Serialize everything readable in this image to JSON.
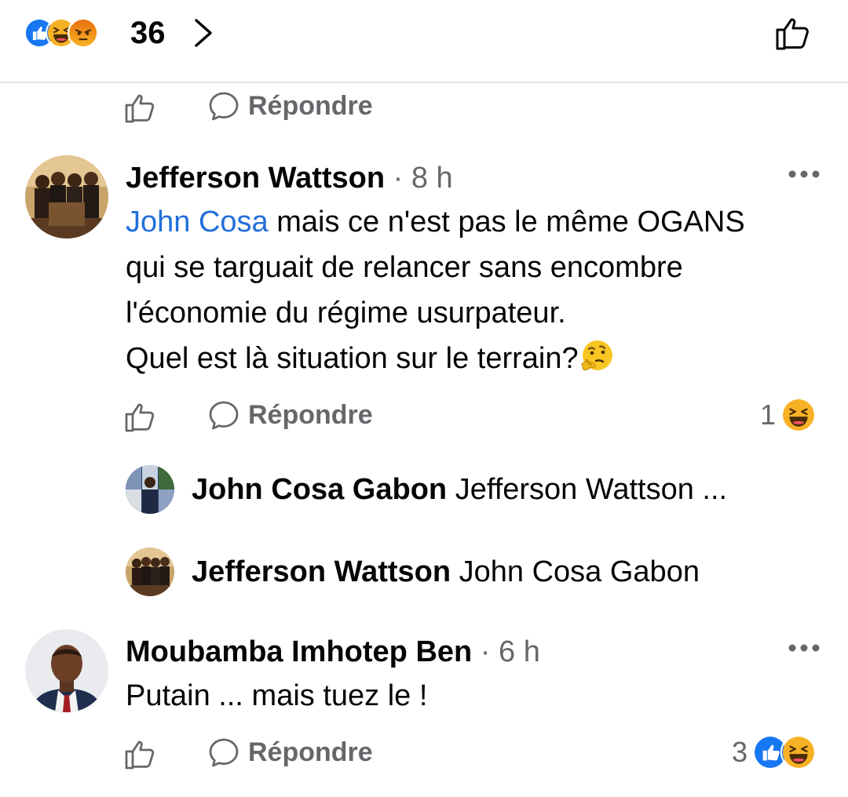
{
  "reactions_bar": {
    "icons": [
      "like-reaction-icon",
      "haha-reaction-icon",
      "angry-reaction-icon"
    ],
    "count": "36",
    "colors": {
      "like": "#1877f2",
      "haha": "#f7b125",
      "angry": "#e9710f"
    }
  },
  "reply_label": "Répondre",
  "comments": [
    {
      "author": "Jefferson Wattson",
      "separator": " · ",
      "time": "8 h",
      "mention": "John Cosa",
      "text_line1": " mais ce n'est pas le même OGANS",
      "text_line2": "qui se targuait de relancer sans encombre",
      "text_line3": "l'économie du régime usurpateur.",
      "text_line4": "Quel est là situation sur le terrain?",
      "inline_emoji": "thinking-face",
      "reaction_count": "1",
      "reaction_icons": [
        "haha-reaction-icon"
      ]
    },
    {
      "author": "Moubamba Imhotep Ben",
      "separator": " · ",
      "time": "6 h",
      "text": "Putain ... mais tuez le !",
      "reaction_count": "3",
      "reaction_icons": [
        "like-reaction-icon",
        "haha-reaction-icon"
      ]
    }
  ],
  "replies": [
    {
      "author": "John Cosa Gabon",
      "preview": " Jefferson Wattson ..."
    },
    {
      "author": "Jefferson Wattson",
      "preview": " John Cosa Gabon"
    }
  ]
}
